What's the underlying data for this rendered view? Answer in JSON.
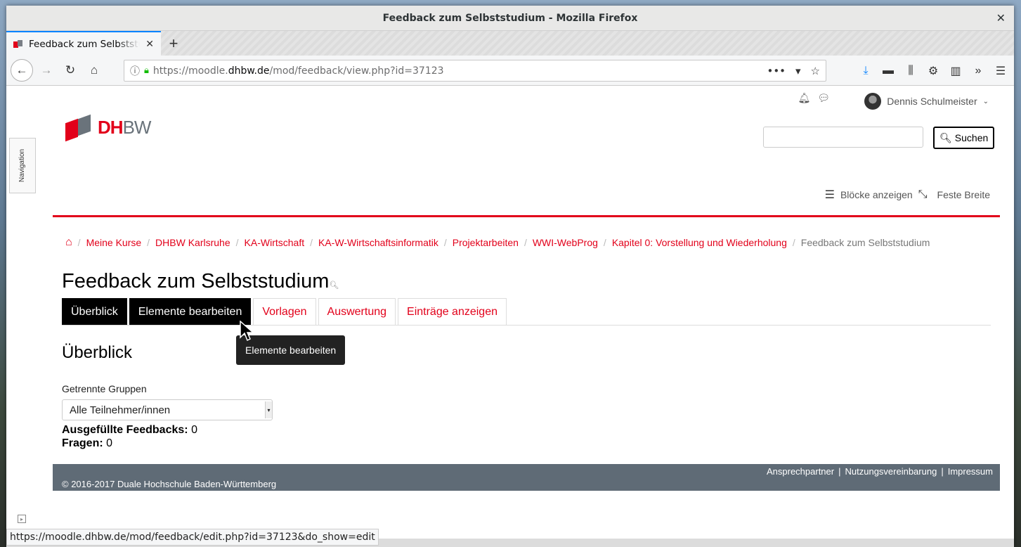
{
  "window": {
    "title": "Feedback zum Selbststudium - Mozilla Firefox"
  },
  "browser": {
    "tab_title": "Feedback zum Selbststudium",
    "url_prefix": "https://moodle.",
    "url_domain": "dhbw.de",
    "url_path": "/mod/feedback/view.php?id=37123",
    "status_url": "https://moodle.dhbw.de/mod/feedback/edit.php?id=37123&do_show=edit"
  },
  "header": {
    "user_name": "Dennis Schulmeister",
    "logo_dh": "DH",
    "logo_bw": "BW",
    "search_button": "Suchen",
    "nav_drawer": "Navigation",
    "blocks_label": "Blöcke anzeigen",
    "fixed_width_label": "Feste Breite"
  },
  "breadcrumb": [
    "Meine Kurse",
    "DHBW Karlsruhe",
    "KA-Wirtschaft",
    "KA-W-Wirtschaftsinformatik",
    "Projektarbeiten",
    "WWI-WebProg",
    "Kapitel 0: Vorstellung und Wiederholung"
  ],
  "breadcrumb_current": "Feedback zum Selbststudium",
  "page": {
    "title": "Feedback zum Selbststudium",
    "tabs": [
      "Überblick",
      "Elemente bearbeiten",
      "Vorlagen",
      "Auswertung",
      "Einträge anzeigen"
    ],
    "tooltip": "Elemente bearbeiten",
    "section_title": "Überblick",
    "groups_label": "Getrennte Gruppen",
    "groups_selected": "Alle Teilnehmer/innen",
    "completed_label": "Ausgefüllte Feedbacks:",
    "completed_value": "0",
    "questions_label": "Fragen:",
    "questions_value": "0"
  },
  "footer": {
    "links": [
      "Ansprechpartner",
      "Nutzungsvereinbarung",
      "Impressum"
    ],
    "copyright": "© 2016-2017 Duale Hochschule Baden-Württemberg"
  },
  "colors": {
    "accent": "#e2001a",
    "footer_bg": "#5f6b76",
    "browser_accent": "#0a84ff"
  }
}
